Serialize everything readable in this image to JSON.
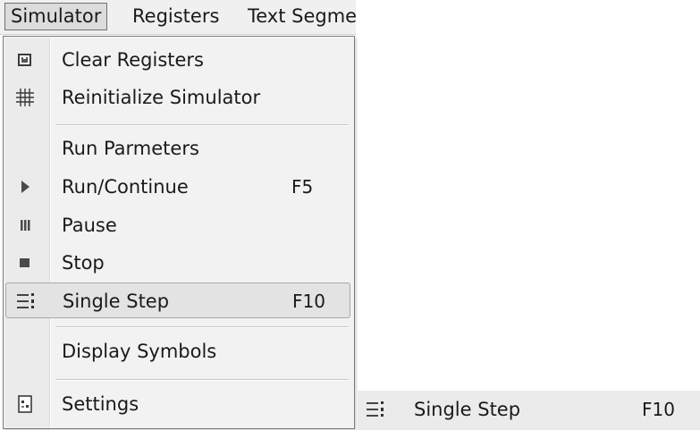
{
  "menubar": {
    "simulator": "Simulator",
    "registers": "Registers",
    "text_segment": "Text Segme"
  },
  "menu": {
    "items": [
      {
        "label": "Clear Registers",
        "icon": "clear-registers-icon"
      },
      {
        "label": "Reinitialize Simulator",
        "icon": "grid-icon"
      },
      {
        "label": "Run Parmeters"
      },
      {
        "label": "Run/Continue",
        "shortcut": "F5",
        "icon": "play-icon"
      },
      {
        "label": "Pause",
        "icon": "pause-icon"
      },
      {
        "label": "Stop",
        "icon": "stop-icon"
      },
      {
        "label": "Single Step",
        "shortcut": "F10",
        "icon": "single-step-icon"
      },
      {
        "label": "Display Symbols"
      },
      {
        "label": "Settings",
        "icon": "settings-icon"
      }
    ]
  },
  "zoom_item": {
    "label": "Single Step",
    "shortcut": "F10",
    "icon": "single-step-icon"
  },
  "colors": {
    "menu_background": "#f2f2f2",
    "highlight_background": "#e3e3e3",
    "menubar_background": "#f0f0f0"
  }
}
